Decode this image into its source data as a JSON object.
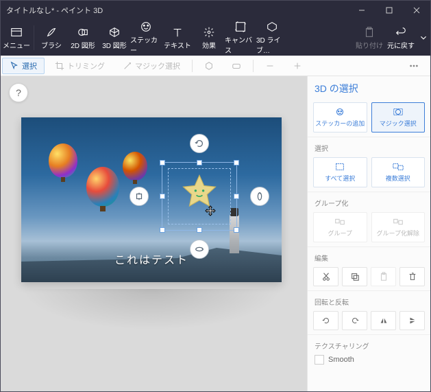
{
  "titlebar": {
    "title": "タイトルなし* - ペイント 3D"
  },
  "ribbon": {
    "menu": "メニュー",
    "brush": "ブラシ",
    "shape2d": "2D 図形",
    "shape3d": "3D 図形",
    "sticker": "ステッカー",
    "text": "テキスト",
    "effect": "効果",
    "canvas": "キャンバス",
    "lib3d": "3D ライブ…",
    "paste": "貼り付け",
    "undo": "元に戻す"
  },
  "toolbar": {
    "select": "選択",
    "trim": "トリミング",
    "magic": "マジック選択"
  },
  "canvas_caption": "これはテスト",
  "help": "?",
  "panel": {
    "title": "3D の選択",
    "add_sticker": "ステッカーの追加",
    "magic_select": "マジック選択",
    "section_select": "選択",
    "select_all": "すべて選択",
    "multi_select": "複数選択",
    "section_group": "グループ化",
    "group": "グループ",
    "ungroup": "グループ化解除",
    "section_edit": "編集",
    "section_rotate": "回転と反転",
    "section_texture": "テクスチャリング",
    "smooth": "Smooth"
  }
}
